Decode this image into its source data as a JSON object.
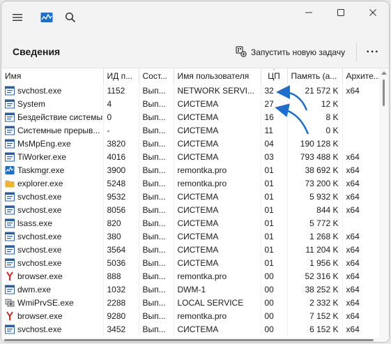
{
  "header": {
    "title": "Сведения",
    "run_task_label": "Запустить новую задачу",
    "more_label": "···"
  },
  "columns": [
    "Имя",
    "ИД п...",
    "Сост...",
    "Имя пользователя",
    "ЦП",
    "Память (а...",
    "Архите..."
  ],
  "sort_indicator": "ˇ",
  "processes": [
    {
      "icon": "svchost-icon",
      "name": "svchost.exe",
      "pid": "1152",
      "status": "Вып...",
      "user": "NETWORK SERVI...",
      "cpu": "32",
      "mem": "21 572 K",
      "arch": "x64"
    },
    {
      "icon": "system-icon",
      "name": "System",
      "pid": "4",
      "status": "Вып...",
      "user": "СИСТЕМА",
      "cpu": "27",
      "mem": "12 K",
      "arch": ""
    },
    {
      "icon": "system-icon",
      "name": "Бездействие системы",
      "pid": "0",
      "status": "Вып...",
      "user": "СИСТЕМА",
      "cpu": "16",
      "mem": "8 K",
      "arch": ""
    },
    {
      "icon": "system-icon",
      "name": "Системные прерыв...",
      "pid": "-",
      "status": "Вып...",
      "user": "СИСТЕМА",
      "cpu": "11",
      "mem": "0 K",
      "arch": ""
    },
    {
      "icon": "svchost-icon",
      "name": "MsMpEng.exe",
      "pid": "3820",
      "status": "Вып...",
      "user": "СИСТЕМА",
      "cpu": "04",
      "mem": "190 128 K",
      "arch": ""
    },
    {
      "icon": "svchost-icon",
      "name": "TiWorker.exe",
      "pid": "4016",
      "status": "Вып...",
      "user": "СИСТЕМА",
      "cpu": "03",
      "mem": "793 488 K",
      "arch": "x64"
    },
    {
      "icon": "taskmgr-icon",
      "name": "Taskmgr.exe",
      "pid": "3900",
      "status": "Вып...",
      "user": "remontka.pro",
      "cpu": "01",
      "mem": "38 692 K",
      "arch": "x64"
    },
    {
      "icon": "folder-icon",
      "name": "explorer.exe",
      "pid": "5248",
      "status": "Вып...",
      "user": "remontka.pro",
      "cpu": "01",
      "mem": "73 200 K",
      "arch": "x64"
    },
    {
      "icon": "svchost-icon",
      "name": "svchost.exe",
      "pid": "9532",
      "status": "Вып...",
      "user": "СИСТЕМА",
      "cpu": "01",
      "mem": "5 932 K",
      "arch": "x64"
    },
    {
      "icon": "svchost-icon",
      "name": "svchost.exe",
      "pid": "8056",
      "status": "Вып...",
      "user": "СИСТЕМА",
      "cpu": "01",
      "mem": "844 K",
      "arch": "x64"
    },
    {
      "icon": "svchost-icon",
      "name": "lsass.exe",
      "pid": "820",
      "status": "Вып...",
      "user": "СИСТЕМА",
      "cpu": "01",
      "mem": "5 772 K",
      "arch": ""
    },
    {
      "icon": "svchost-icon",
      "name": "svchost.exe",
      "pid": "380",
      "status": "Вып...",
      "user": "СИСТЕМА",
      "cpu": "01",
      "mem": "1 268 K",
      "arch": "x64"
    },
    {
      "icon": "svchost-icon",
      "name": "svchost.exe",
      "pid": "3564",
      "status": "Вып...",
      "user": "СИСТЕМА",
      "cpu": "01",
      "mem": "11 204 K",
      "arch": "x64"
    },
    {
      "icon": "svchost-icon",
      "name": "svchost.exe",
      "pid": "5036",
      "status": "Вып...",
      "user": "СИСТЕМА",
      "cpu": "01",
      "mem": "1 956 K",
      "arch": "x64"
    },
    {
      "icon": "browser-icon",
      "name": "browser.exe",
      "pid": "888",
      "status": "Вып...",
      "user": "remontka.pro",
      "cpu": "00",
      "mem": "52 316 K",
      "arch": "x64"
    },
    {
      "icon": "svchost-icon",
      "name": "dwm.exe",
      "pid": "1032",
      "status": "Вып...",
      "user": "DWM-1",
      "cpu": "00",
      "mem": "38 252 K",
      "arch": "x64"
    },
    {
      "icon": "wmi-icon",
      "name": "WmiPrvSE.exe",
      "pid": "2288",
      "status": "Вып...",
      "user": "LOCAL SERVICE",
      "cpu": "00",
      "mem": "2 332 K",
      "arch": "x64"
    },
    {
      "icon": "browser-icon",
      "name": "browser.exe",
      "pid": "9280",
      "status": "Вып...",
      "user": "remontka.pro",
      "cpu": "00",
      "mem": "7 152 K",
      "arch": "x64"
    },
    {
      "icon": "svchost-icon",
      "name": "svchost.exe",
      "pid": "3452",
      "status": "Вып...",
      "user": "СИСТЕМА",
      "cpu": "00",
      "mem": "6 152 K",
      "arch": "x64"
    }
  ],
  "colors": {
    "accent": "#1a6fd0",
    "window_bg": "#f3f3f3",
    "table_bg": "#ffffff",
    "browser_red": "#e02020",
    "folder_yellow": "#f2b62b"
  }
}
